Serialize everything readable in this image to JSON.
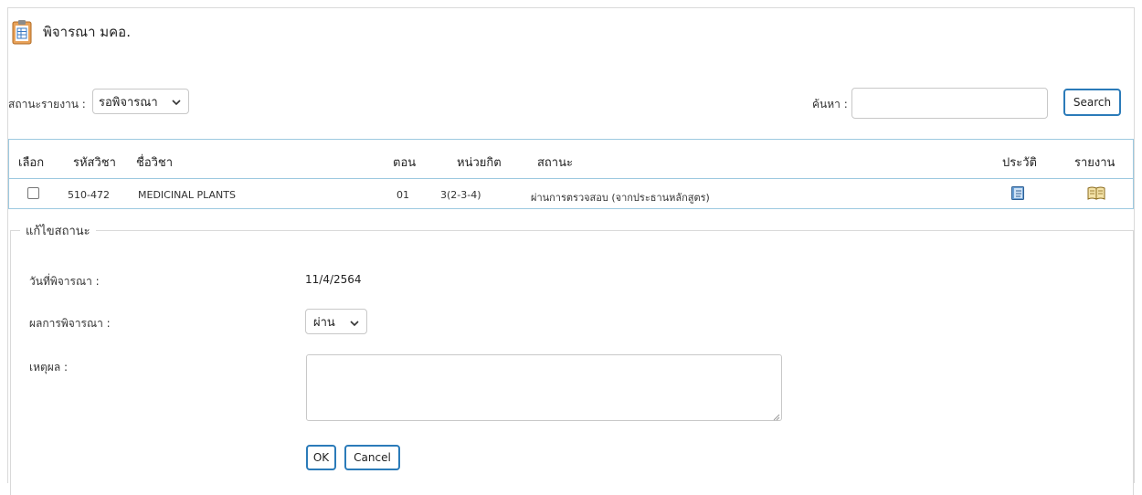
{
  "page": {
    "title": "พิจารณา มคอ."
  },
  "filter": {
    "status_label": "สถานะรายงาน :",
    "status_selected": "รอพิจารณา",
    "search_label": "ค้นหา :",
    "search_value": "",
    "search_button": "Search"
  },
  "table": {
    "headers": {
      "select": "เลือก",
      "code": "รหัสวิชา",
      "name": "ชื่อวิชา",
      "section": "ตอน",
      "credits": "หน่วยกิต",
      "status": "สถานะ",
      "history": "ประวัติ",
      "report": "รายงาน"
    },
    "rows": [
      {
        "code": "510-472",
        "name": "MEDICINAL PLANTS",
        "section": "01",
        "credits": "3(2-3-4)",
        "status": "ผ่านการตรวจสอบ (จากประธานหลักสูตร)",
        "history_icon": "history-book-icon",
        "report_icon": "open-book-icon"
      }
    ]
  },
  "edit": {
    "legend": "แก้ไขสถานะ",
    "date_label": "วันที่พิจารณา :",
    "date_value": "11/4/2564",
    "result_label": "ผลการพิจารณา :",
    "result_selected": "ผ่าน",
    "reason_label": "เหตุผล :",
    "reason_value": "",
    "ok_button": "OK",
    "cancel_button": "Cancel"
  },
  "colors": {
    "accent": "#2b7bb9",
    "table_border": "#9cc9e0",
    "border": "#d9d9d9"
  }
}
